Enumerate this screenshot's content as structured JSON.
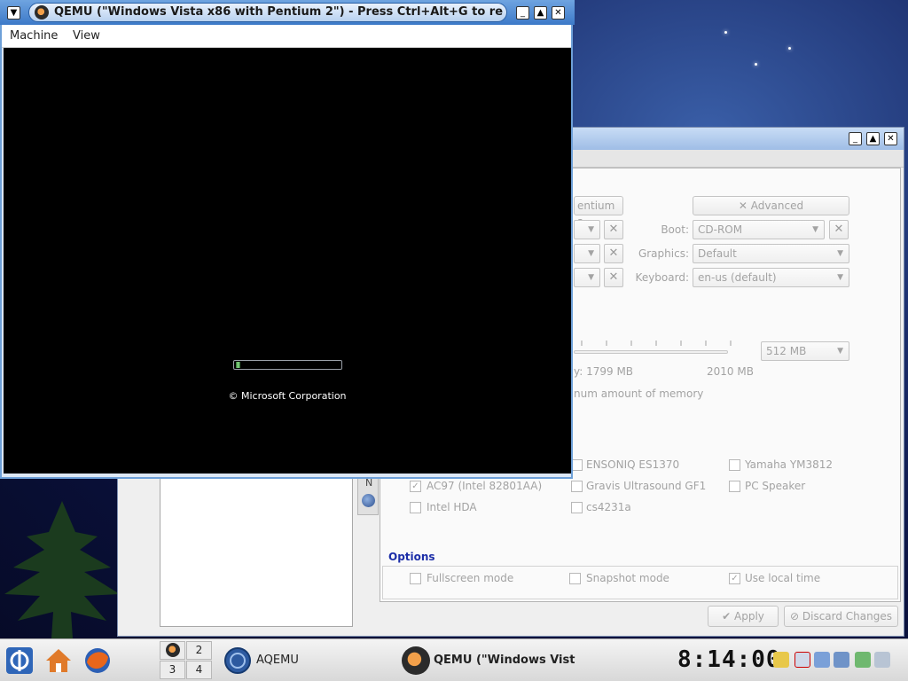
{
  "qemu_window": {
    "title": "QEMU (\"Windows Vista x86 with Pentium 2\") - Press Ctrl+Alt+G to re",
    "menu": [
      "Machine",
      "View"
    ],
    "screen": {
      "copyright": "© Microsoft Corporation",
      "progress": 0.04
    }
  },
  "aqemu_window": {
    "cpu_button": "entium 2",
    "advanced_button": "Advanced",
    "boot_label": "Boot:",
    "boot_value": "CD-ROM",
    "graphics_label": "Graphics:",
    "graphics_value": "Default",
    "keyboard_label": "Keyboard:",
    "keyboard_value": "en-us (default)",
    "memory_value": "512 MB",
    "memory_free_text": "y: 1799 MB",
    "memory_total_text": "2010 MB",
    "memory_hint": "num amount of memory",
    "sidetab_letter": "N",
    "sound_cards": [
      {
        "label": "ENSONIQ ES1370",
        "checked": false
      },
      {
        "label": "Yamaha YM3812",
        "checked": false
      },
      {
        "label": "AC97 (Intel 82801AA)",
        "checked": true
      },
      {
        "label": "Gravis Ultrasound GF1",
        "checked": false
      },
      {
        "label": "PC Speaker",
        "checked": false
      },
      {
        "label": "Intel HDA",
        "checked": false
      },
      {
        "label": "cs4231a",
        "checked": false
      }
    ],
    "options_title": "Options",
    "options": [
      {
        "label": "Fullscreen mode",
        "checked": false
      },
      {
        "label": "Snapshot mode",
        "checked": false
      },
      {
        "label": "Use local time",
        "checked": true
      }
    ],
    "apply_button": "Apply",
    "discard_button": "Discard Changes"
  },
  "taskbar": {
    "pager": [
      "2",
      "3",
      "4"
    ],
    "tasks": [
      {
        "label": "AQEMU"
      },
      {
        "label": "QEMU (\"Windows Vist"
      }
    ],
    "clock": "8:14:00"
  },
  "colors": {
    "accent": "#1c2ea8",
    "titlebar": "#3c79c8"
  }
}
